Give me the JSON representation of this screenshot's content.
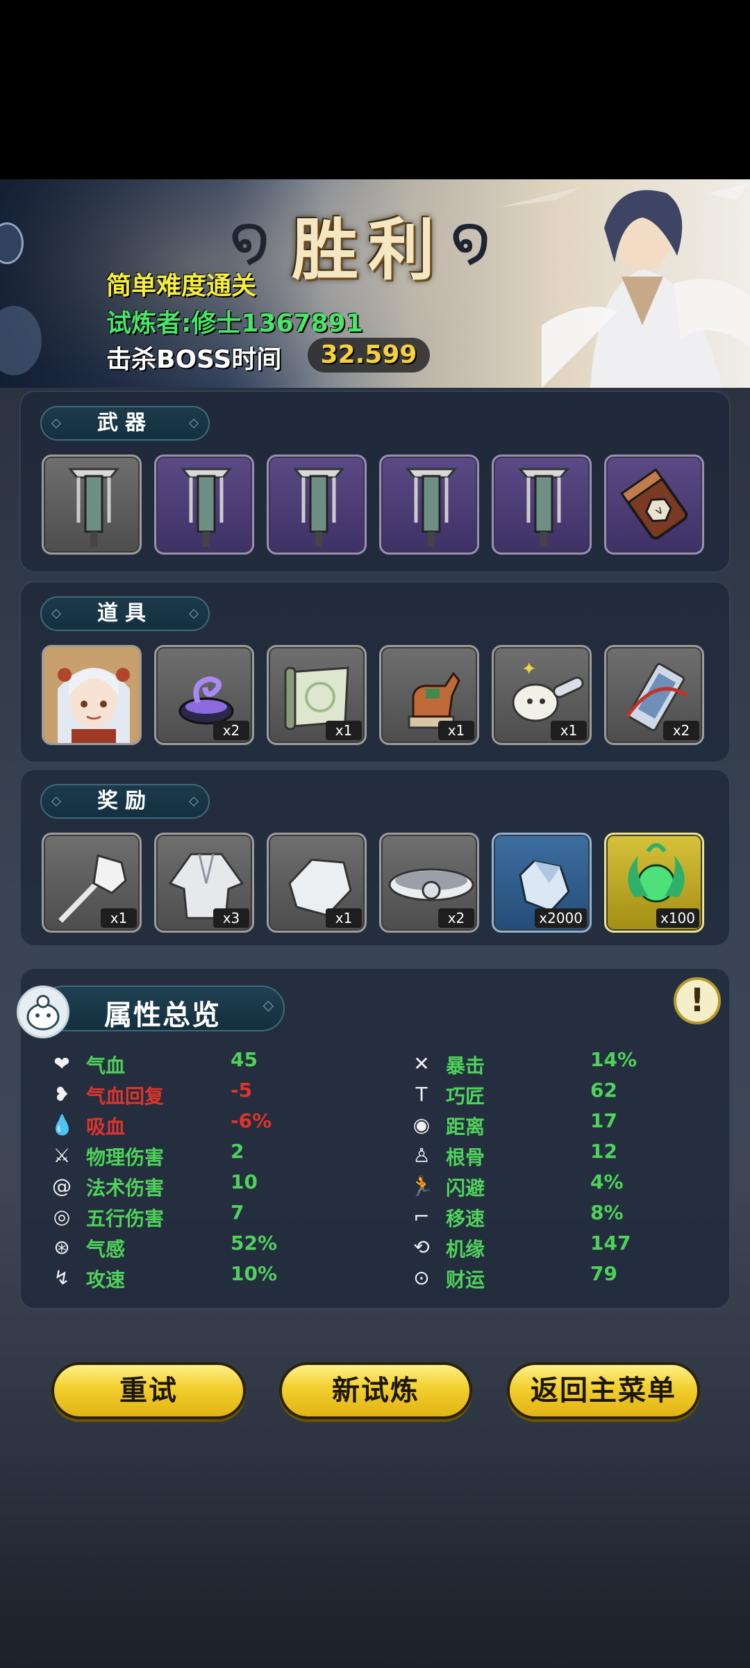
{
  "banner": {
    "title": "胜利",
    "difficulty": "简单难度通关",
    "trainer": "试炼者:修士1367891",
    "boss_time_label": "击杀BOSS时间",
    "boss_time_value": "32.599"
  },
  "weapons": {
    "label": "武器",
    "slots": [
      {
        "icon": "banner-weapon-icon",
        "rarity": "gray"
      },
      {
        "icon": "banner-weapon-icon",
        "rarity": "purple"
      },
      {
        "icon": "banner-weapon-icon",
        "rarity": "purple"
      },
      {
        "icon": "banner-weapon-icon",
        "rarity": "purple"
      },
      {
        "icon": "banner-weapon-icon",
        "rarity": "purple"
      },
      {
        "icon": "gauntlet-weapon-icon",
        "rarity": "purple"
      }
    ]
  },
  "items": {
    "label": "道具",
    "slots": [
      {
        "icon": "character-portrait-icon",
        "qty": ""
      },
      {
        "icon": "purple-bowl-icon",
        "qty": "x2"
      },
      {
        "icon": "scroll-map-icon",
        "qty": "x1"
      },
      {
        "icon": "horse-statue-icon",
        "qty": "x1"
      },
      {
        "icon": "spoon-icon",
        "qty": "x1"
      },
      {
        "icon": "talisman-icon",
        "qty": "x2"
      }
    ]
  },
  "rewards": {
    "label": "奖励",
    "slots": [
      {
        "icon": "mace-icon",
        "qty": "x1",
        "rarity": "gray"
      },
      {
        "icon": "robe-icon",
        "qty": "x3",
        "rarity": "gray"
      },
      {
        "icon": "bracer-icon",
        "qty": "x1",
        "rarity": "gray"
      },
      {
        "icon": "belt-icon",
        "qty": "x2",
        "rarity": "gray"
      },
      {
        "icon": "crystal-icon",
        "qty": "x2000",
        "rarity": "blue"
      },
      {
        "icon": "jade-orb-icon",
        "qty": "x100",
        "rarity": "gold"
      }
    ]
  },
  "attributes": {
    "title": "属性总览",
    "left": [
      {
        "icon": "heart-icon",
        "name": "气血",
        "value": "45",
        "negative": false
      },
      {
        "icon": "heart-regen-icon",
        "name": "气血回复",
        "value": "-5",
        "negative": true
      },
      {
        "icon": "blood-drop-icon",
        "name": "吸血",
        "value": "-6%",
        "negative": true
      },
      {
        "icon": "sword-icon",
        "name": "物理伤害",
        "value": "2",
        "negative": false
      },
      {
        "icon": "spiral-icon",
        "name": "法术伤害",
        "value": "10",
        "negative": false
      },
      {
        "icon": "element-ring-icon",
        "name": "五行伤害",
        "value": "7",
        "negative": false
      },
      {
        "icon": "qi-sense-icon",
        "name": "气感",
        "value": "52%",
        "negative": false
      },
      {
        "icon": "attack-speed-icon",
        "name": "攻速",
        "value": "10%",
        "negative": false
      }
    ],
    "right": [
      {
        "icon": "crit-icon",
        "name": "暴击",
        "value": "14%",
        "negative": false
      },
      {
        "icon": "hammer-icon",
        "name": "巧匠",
        "value": "62",
        "negative": false
      },
      {
        "icon": "target-icon",
        "name": "距离",
        "value": "17",
        "negative": false
      },
      {
        "icon": "meditate-icon",
        "name": "根骨",
        "value": "12",
        "negative": false
      },
      {
        "icon": "dodge-icon",
        "name": "闪避",
        "value": "4%",
        "negative": false
      },
      {
        "icon": "boot-icon",
        "name": "移速",
        "value": "8%",
        "negative": false
      },
      {
        "icon": "luck-cycle-icon",
        "name": "机缘",
        "value": "147",
        "negative": false
      },
      {
        "icon": "coin-icon",
        "name": "财运",
        "value": "79",
        "negative": false
      }
    ]
  },
  "actions": {
    "retry": "重试",
    "new_trial": "新试炼",
    "main_menu": "返回主菜单"
  }
}
